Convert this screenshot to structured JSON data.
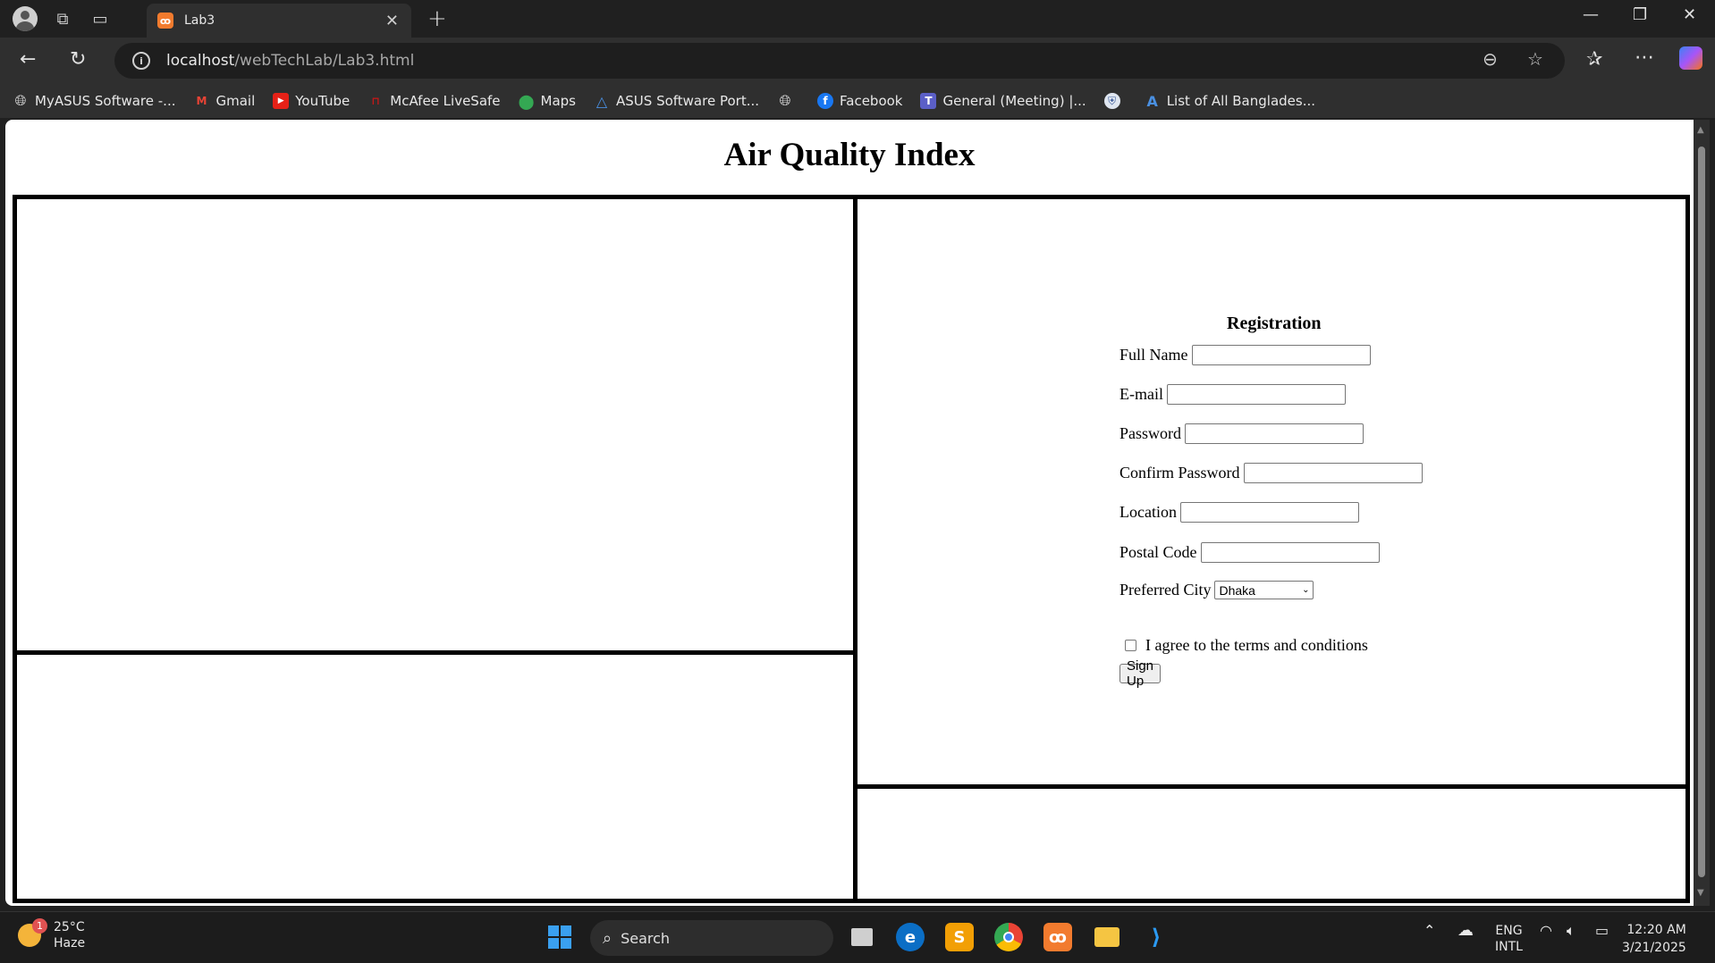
{
  "browser": {
    "tab_title": "Lab3",
    "tab_favicon": "xampp-icon",
    "url_host": "localhost",
    "url_path": "/webTechLab/Lab3.html"
  },
  "bookmarks": [
    {
      "label": "MyASUS Software -...",
      "icon": "globe-icon"
    },
    {
      "label": "Gmail",
      "icon": "gmail-icon"
    },
    {
      "label": "YouTube",
      "icon": "youtube-icon"
    },
    {
      "label": "McAfee LiveSafe",
      "icon": "mcafee-icon"
    },
    {
      "label": "Maps",
      "icon": "maps-icon"
    },
    {
      "label": "ASUS Software Port...",
      "icon": "asus-icon"
    },
    {
      "label": "",
      "icon": "globe-icon"
    },
    {
      "label": "Facebook",
      "icon": "facebook-icon"
    },
    {
      "label": "General (Meeting) |...",
      "icon": "teams-icon"
    },
    {
      "label": "",
      "icon": "shield-icon"
    },
    {
      "label": "List of All Banglades...",
      "icon": "letter-a-icon"
    }
  ],
  "page": {
    "title": "Air Quality Index",
    "form": {
      "title": "Registration",
      "full_name_label": "Full Name",
      "email_label": "E-mail",
      "password_label": "Password",
      "confirm_password_label": "Confirm Password",
      "location_label": "Location",
      "postal_code_label": "Postal Code",
      "preferred_city_label": "Preferred City",
      "preferred_city_value": "Dhaka",
      "terms_label": "I agree to the terms and conditions",
      "signup_label": "Sign Up"
    }
  },
  "taskbar": {
    "weather_temp": "25°C",
    "weather_desc": "Haze",
    "weather_badge": "1",
    "search_label": "Search",
    "lang_top": "ENG",
    "lang_bottom": "INTL",
    "time": "12:20 AM",
    "date": "3/21/2025"
  },
  "colors": {
    "browser_bg": "#202020",
    "toolbar_bg": "#2f2f2f",
    "page_bg": "#ffffff",
    "border": "#000000",
    "xampp_orange": "#f27b2e"
  }
}
